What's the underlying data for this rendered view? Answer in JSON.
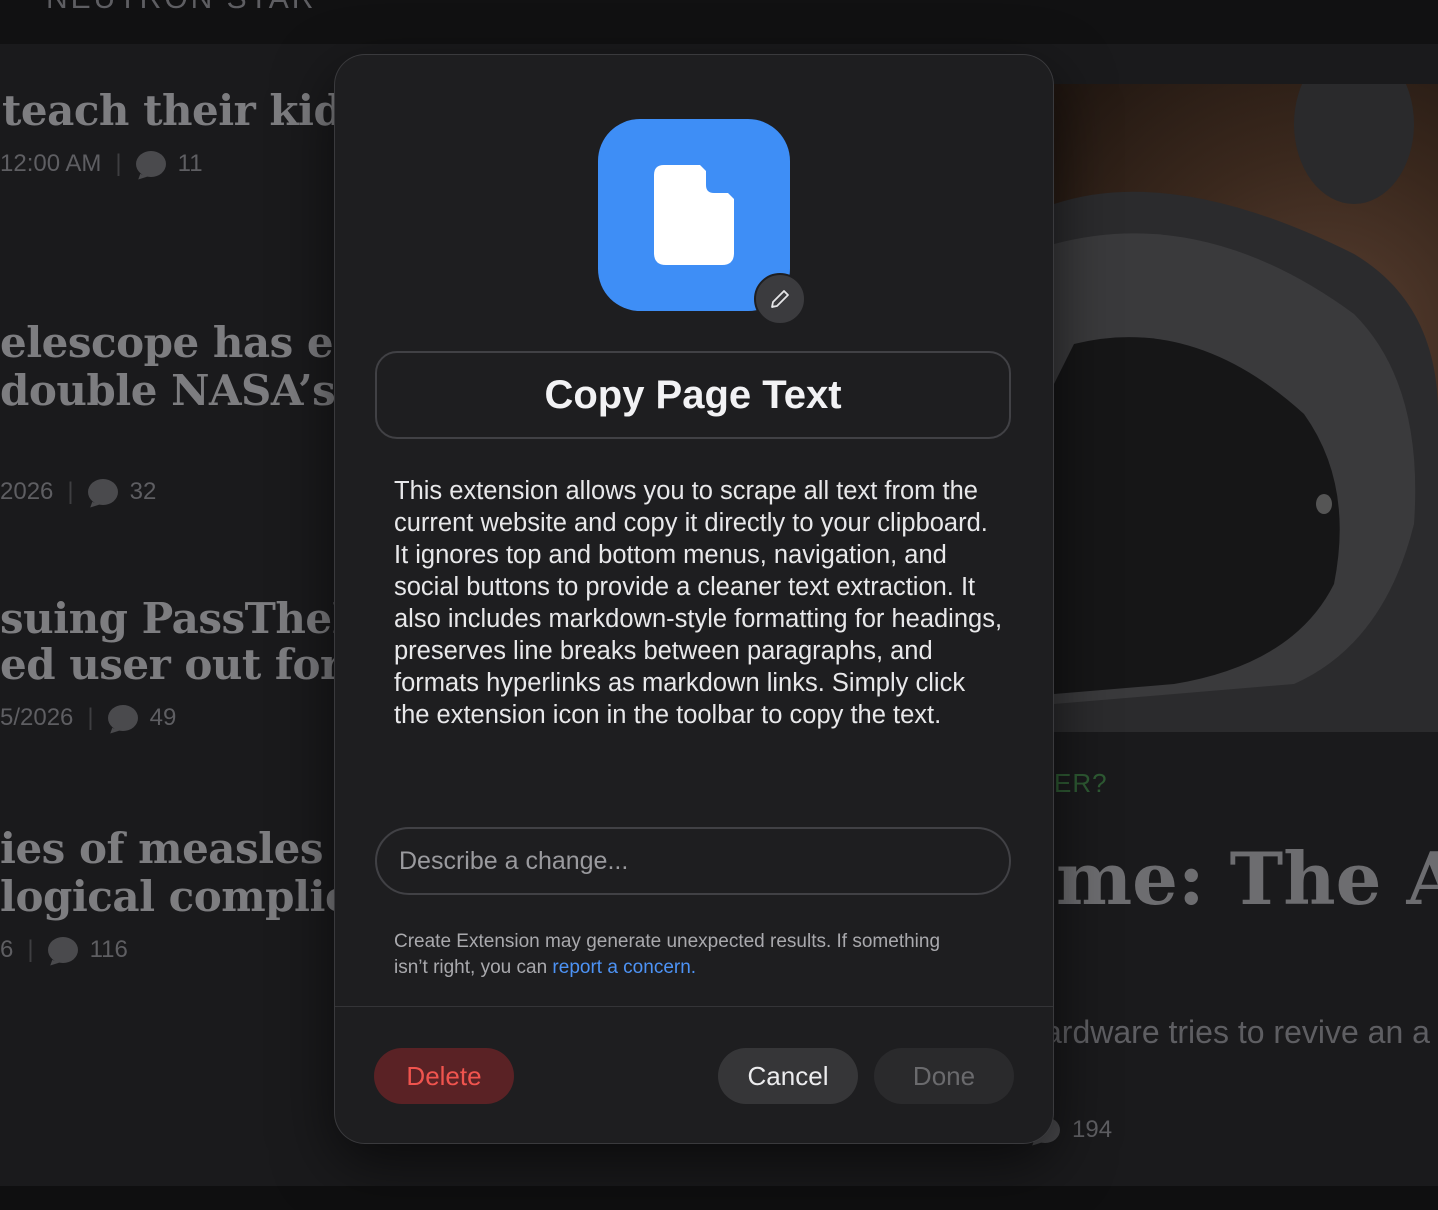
{
  "background": {
    "topbar_label": "NEUTRON STAR",
    "articles": [
      {
        "line1": "teach their kids",
        "line2": "",
        "meta_time": "12:00 AM",
        "comments": "11"
      },
      {
        "line1": "elescope has enc",
        "line2": "double NASA’s",
        "meta_time": "2026",
        "comments": "32"
      },
      {
        "line1": " suing PassTheP",
        "line2": "ed user out for re",
        "meta_time": "5/2026",
        "comments": "49"
      },
      {
        "line1": "ies of measles in",
        "line2": "logical complica",
        "meta_time": "6",
        "comments": "116"
      }
    ],
    "right_kicker": "ER?",
    "right_headline": "me: The Ars",
    "right_sub": "ardware tries to revive an a",
    "right_comments": "194"
  },
  "dialog": {
    "icon": "document-icon",
    "badge_icon": "pencil-icon",
    "name": "Copy Page Text",
    "description": "This extension allows you to scrape all text from the current website and copy it directly to your clipboard. It ignores top and bottom menus, navigation, and social buttons to provide a cleaner text extraction. It also includes markdown-style formatting for headings, preserves line breaks between paragraphs, and formats hyperlinks as markdown links. Simply click the extension icon in the toolbar to copy the text.",
    "change_input": {
      "value": "",
      "placeholder": "Describe a change..."
    },
    "disclaimer_text": "Create Extension may generate unexpected results. If something isn’t right, you can ",
    "disclaimer_link": "report a concern.",
    "buttons": {
      "delete": "Delete",
      "cancel": "Cancel",
      "done": "Done"
    },
    "colors": {
      "icon_blue": "#3e8ef6",
      "link_blue": "#4d93f5",
      "delete_red": "#f0544e",
      "delete_bg": "#5a2225"
    }
  }
}
